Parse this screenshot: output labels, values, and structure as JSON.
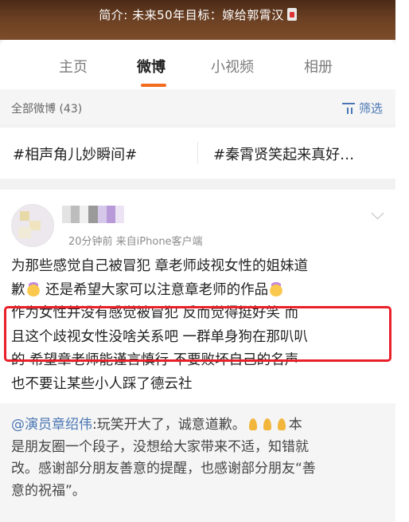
{
  "banner": {
    "text": "简介: 未来50年目标：嫁给郭霄汉",
    "icon": "phone-icon"
  },
  "tabs": [
    {
      "label": "主页"
    },
    {
      "label": "微博",
      "active": true
    },
    {
      "label": "小视频"
    },
    {
      "label": "相册"
    }
  ],
  "filter": {
    "count_label": "全部微博 (43)",
    "filter_label": "筛选"
  },
  "hashtags": [
    {
      "label": "#相声角儿妙瞬间#"
    },
    {
      "label": "#秦霄贤笑起来真好…"
    }
  ],
  "post": {
    "meta": "20分钟前  来自iPhone客户端",
    "lines": [
      "为那些感觉自己被冒犯 章老师歧视女性的姐妹道",
      "歉",
      "还是希望大家可以注意章老师的作品",
      "作为女性并没有感觉被冒犯 反而觉得挺好笑 而",
      "且这个歧视女性没啥关系吧 一群单身狗在那叭叭",
      "的  希望章老师能谨言慎行 不要败坏自己的名声",
      "也不要让某些小人踩了德云社"
    ],
    "repost": {
      "mention": "@演员章绍伟",
      "line1_rest": ":玩笑开大了，诚意道歉。",
      "line1_end": "本",
      "line2": "是朋友圈一个段子，没想给大家带来不适，知错就",
      "line3": "改。感谢部分朋友善意的提醒，也感谢部分朋友“善",
      "line4": "意的祝福”。"
    }
  },
  "colors": {
    "accent": "#f26b1f",
    "link": "#4a77b4",
    "highlight": "#e8202a"
  }
}
